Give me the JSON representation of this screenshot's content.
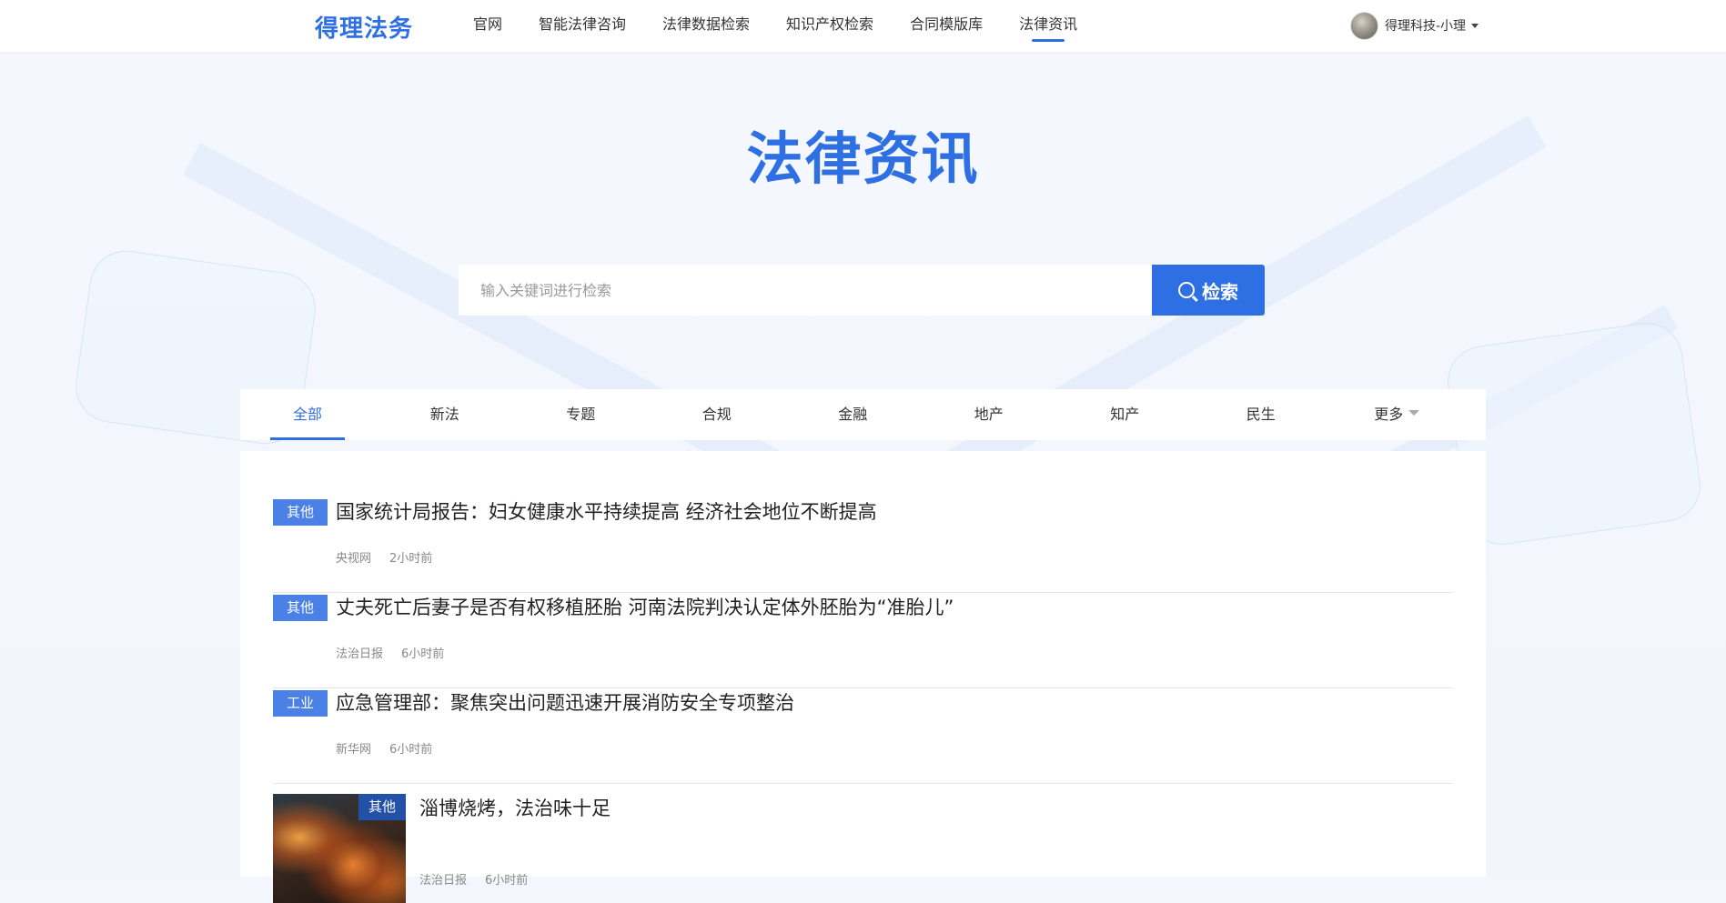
{
  "header": {
    "logo": "得理法务",
    "nav": [
      {
        "label": "官网",
        "active": false
      },
      {
        "label": "智能法律咨询",
        "active": false
      },
      {
        "label": "法律数据检索",
        "active": false
      },
      {
        "label": "知识产权检索",
        "active": false
      },
      {
        "label": "合同模版库",
        "active": false
      },
      {
        "label": "法律资讯",
        "active": true
      }
    ],
    "user_name": "得理科技-小理"
  },
  "hero": {
    "title": "法律资讯",
    "search_placeholder": "输入关键词进行检索",
    "search_button": "检索"
  },
  "tabs": [
    {
      "label": "全部",
      "active": true
    },
    {
      "label": "新法",
      "active": false
    },
    {
      "label": "专题",
      "active": false
    },
    {
      "label": "合规",
      "active": false
    },
    {
      "label": "金融",
      "active": false
    },
    {
      "label": "地产",
      "active": false
    },
    {
      "label": "知产",
      "active": false
    },
    {
      "label": "民生",
      "active": false
    },
    {
      "label": "更多",
      "active": false
    }
  ],
  "news": [
    {
      "tag": "其他",
      "title": "国家统计局报告：妇女健康水平持续提高 经济社会地位不断提高",
      "source": "央视网",
      "time": "2小时前"
    },
    {
      "tag": "其他",
      "title": "丈夫死亡后妻子是否有权移植胚胎 河南法院判决认定体外胚胎为“准胎儿”",
      "source": "法治日报",
      "time": "6小时前"
    },
    {
      "tag": "工业",
      "title": "应急管理部：聚焦突出问题迅速开展消防安全专项整治",
      "source": "新华网",
      "time": "6小时前"
    },
    {
      "tag": "其他",
      "title": "淄博烧烤，法治味十足",
      "source": "法治日报",
      "time": "6小时前"
    }
  ],
  "colors": {
    "accent": "#2f6fe4",
    "tag": "#4b80e6",
    "tag_on_image": "#2451a8"
  }
}
